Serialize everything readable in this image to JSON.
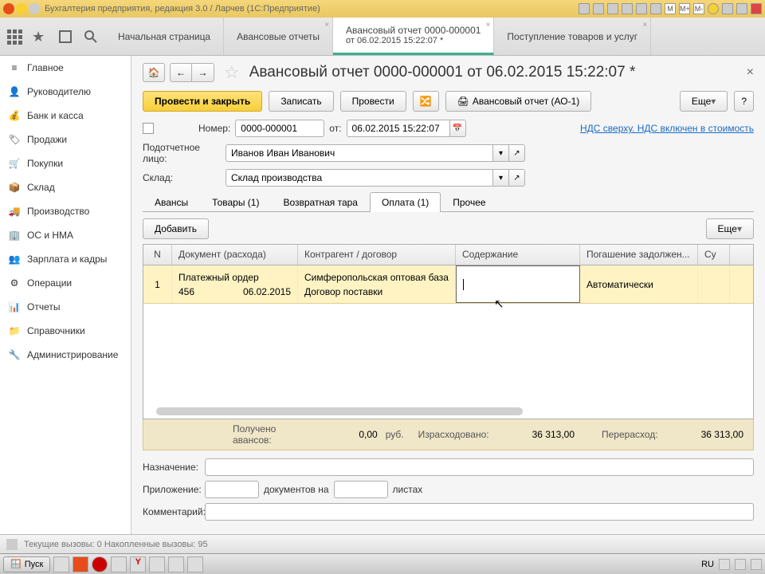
{
  "titlebar": {
    "text": "Бухгалтерия предприятия, редакция 3.0 / Ларчев  (1С:Предприятие)"
  },
  "main_tabs": [
    {
      "label": "Начальная страница",
      "sub": ""
    },
    {
      "label": "Авансовые отчеты",
      "sub": ""
    },
    {
      "label": "Авансовый отчет 0000-000001",
      "sub": "от 06.02.2015 15:22:07 *"
    },
    {
      "label": "Поступление товаров и услуг",
      "sub": ""
    }
  ],
  "sidebar": {
    "items": [
      {
        "label": "Главное"
      },
      {
        "label": "Руководителю"
      },
      {
        "label": "Банк и касса"
      },
      {
        "label": "Продажи"
      },
      {
        "label": "Покупки"
      },
      {
        "label": "Склад"
      },
      {
        "label": "Производство"
      },
      {
        "label": "ОС и НМА"
      },
      {
        "label": "Зарплата и кадры"
      },
      {
        "label": "Операции"
      },
      {
        "label": "Отчеты"
      },
      {
        "label": "Справочники"
      },
      {
        "label": "Администрирование"
      }
    ]
  },
  "page": {
    "title": "Авансовый отчет 0000-000001 от 06.02.2015 15:22:07 *"
  },
  "actions": {
    "post_close": "Провести и закрыть",
    "save": "Записать",
    "post": "Провести",
    "print": "Авансовый отчет (АО-1)",
    "more": "Еще",
    "help": "?"
  },
  "form": {
    "number_label": "Номер:",
    "number": "0000-000001",
    "from_label": "от:",
    "date": "06.02.2015 15:22:07",
    "vat_link": "НДС сверху. НДС включен в стоимость",
    "person_label": "Подотчетное лицо:",
    "person": "Иванов Иван Иванович",
    "warehouse_label": "Склад:",
    "warehouse": "Склад производства"
  },
  "form_tabs": [
    {
      "label": "Авансы"
    },
    {
      "label": "Товары (1)"
    },
    {
      "label": "Возвратная тара"
    },
    {
      "label": "Оплата (1)"
    },
    {
      "label": "Прочее"
    }
  ],
  "table_actions": {
    "add": "Добавить",
    "more": "Еще"
  },
  "grid": {
    "headers": [
      "N",
      "Документ (расхода)",
      "Контрагент / договор",
      "Содержание",
      "Погашение задолжен...",
      "Су"
    ],
    "row": {
      "n": "1",
      "doc_type": "Платежный ордер",
      "doc_num": "456",
      "doc_date": "06.02.2015",
      "counterparty": "Симферопольская оптовая база",
      "contract": "Договор поставки",
      "content": "",
      "repayment": "Автоматически"
    }
  },
  "totals": {
    "received_label": "Получено авансов:",
    "received": "0,00",
    "currency": "руб.",
    "spent_label": "Израсходовано:",
    "spent": "36 313,00",
    "over_label": "Перерасход:",
    "over": "36 313,00"
  },
  "bottom": {
    "purpose_label": "Назначение:",
    "attachment_label": "Приложение:",
    "docs_on": "документов на",
    "sheets": "листах",
    "comment_label": "Комментарий:"
  },
  "statusbar": {
    "text": "Текущие вызовы: 0   Накопленные вызовы: 95"
  },
  "taskbar": {
    "start": "Пуск",
    "lang": "RU"
  }
}
